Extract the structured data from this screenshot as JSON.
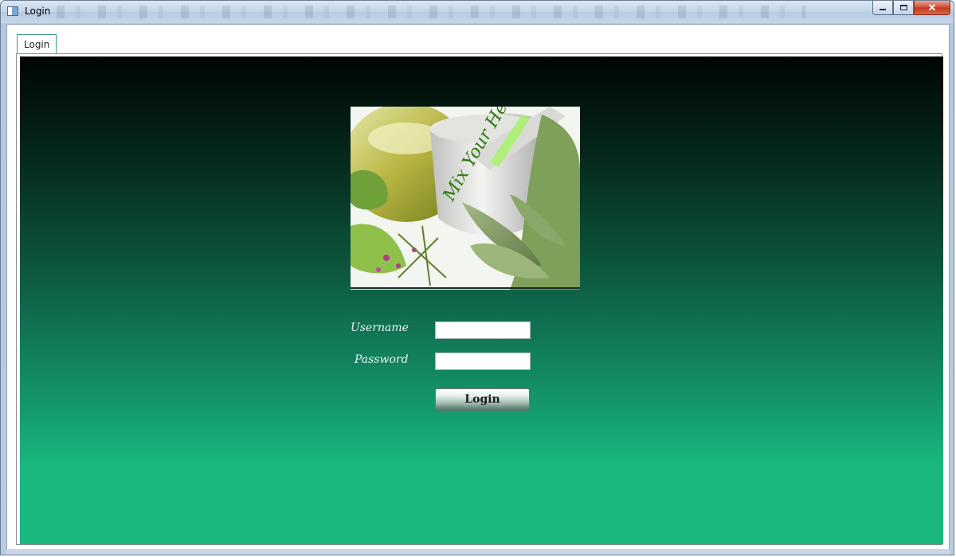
{
  "window": {
    "title": "Login",
    "close_glyph": "✕"
  },
  "tabs": [
    {
      "label": "Login"
    }
  ],
  "logo": {
    "image_text": "Mix Your Health"
  },
  "form": {
    "username_label": "Username",
    "password_label": "Password",
    "username_value": "",
    "password_value": "",
    "login_button": "Login"
  },
  "colors": {
    "gradient_top": "#000503",
    "gradient_bottom": "#19b87e",
    "tab_border": "#3c9a7e"
  }
}
